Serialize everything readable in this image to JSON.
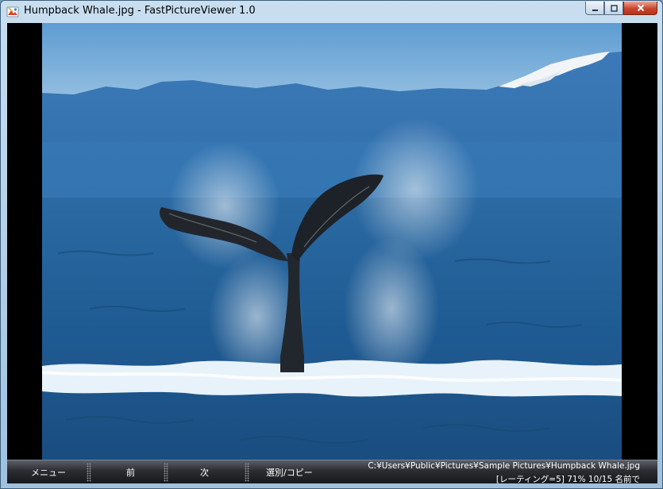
{
  "window": {
    "title": "Humpback Whale.jpg - FastPictureViewer 1.0",
    "app_icon": "fastpictureviewer-icon"
  },
  "caption_buttons": {
    "minimize": "minimize-icon",
    "maximize": "maximize-icon",
    "close": "close-icon"
  },
  "toolbar": {
    "menu_label": "メニュー",
    "prev_label": "前",
    "next_label": "次",
    "select_copy_label": "選別/コピー",
    "file_path": "C:¥Users¥Public¥Pictures¥Sample Pictures¥Humpback Whale.jpg",
    "status": "[レーティング=5] 71%  10/15  名前で"
  },
  "colors": {
    "toolbar_bg": "#2b2d31",
    "close_button": "#c9452c"
  }
}
